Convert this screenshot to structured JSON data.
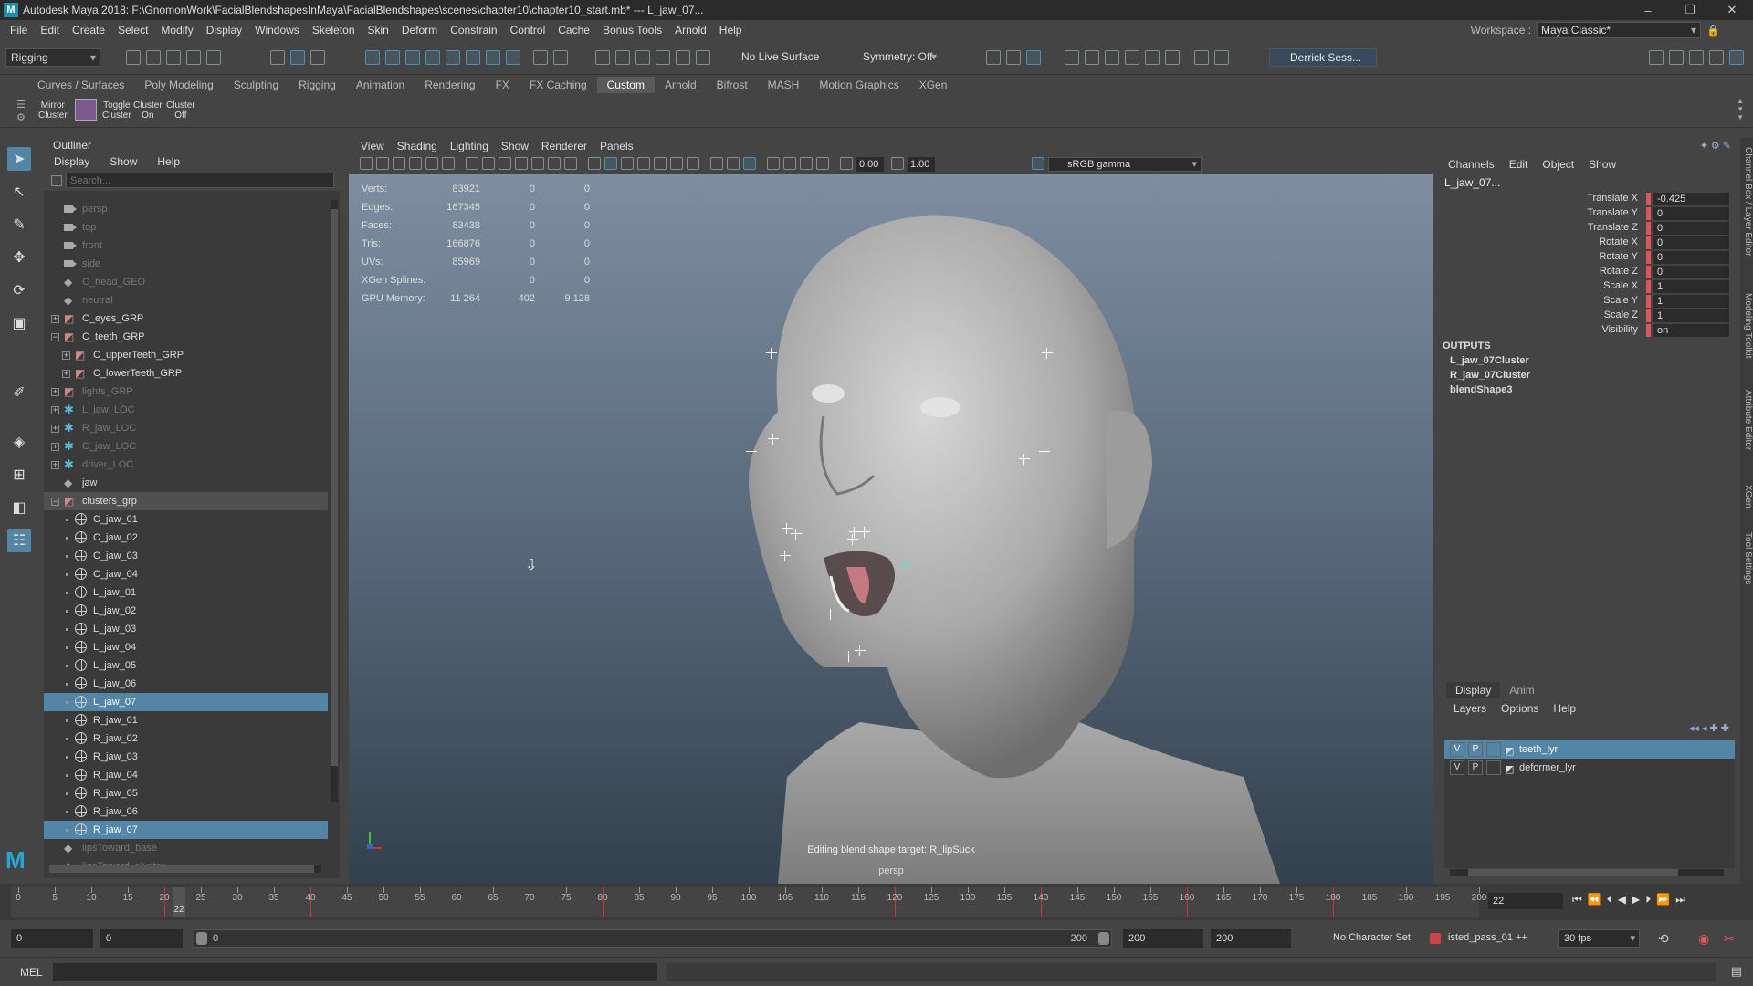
{
  "window": {
    "title": "Autodesk Maya 2018: F:\\GnomonWork\\FacialBlendshapesInMaya\\FacialBlendshapes\\scenes\\chapter10\\chapter10_start.mb*  ---  L_jaw_07...",
    "logo": "M"
  },
  "menu": [
    "File",
    "Edit",
    "Create",
    "Select",
    "Modify",
    "Display",
    "Windows",
    "Skeleton",
    "Skin",
    "Deform",
    "Constrain",
    "Control",
    "Cache",
    "Bonus Tools",
    "Arnold",
    "Help"
  ],
  "workspace": {
    "label": "Workspace :",
    "value": "Maya Classic*"
  },
  "statusline": {
    "mode": "Rigging",
    "live_surface": "No Live Surface",
    "symmetry": "Symmetry: Off",
    "user": "Derrick Sess..."
  },
  "shelf_tabs": [
    "Curves / Surfaces",
    "Poly Modeling",
    "Sculpting",
    "Rigging",
    "Animation",
    "Rendering",
    "FX",
    "FX Caching",
    "Custom",
    "Arnold",
    "Bifrost",
    "MASH",
    "Motion Graphics",
    "XGen"
  ],
  "shelf_items": [
    {
      "l1": "Mirror",
      "l2": "Cluster"
    },
    {
      "l1": "Toggle",
      "l2": "Cluster"
    },
    {
      "l1": "Cluster",
      "l2": "On"
    },
    {
      "l1": "Cluster",
      "l2": "Off"
    }
  ],
  "outliner": {
    "title": "Outliner",
    "menu": [
      "Display",
      "Show",
      "Help"
    ],
    "search_placeholder": "Search...",
    "rows": [
      {
        "label": "persp",
        "icon": "camera-icon",
        "indent": 0,
        "dim": true
      },
      {
        "label": "top",
        "icon": "camera-icon",
        "indent": 0,
        "dim": true
      },
      {
        "label": "front",
        "icon": "camera-icon",
        "indent": 0,
        "dim": true
      },
      {
        "label": "side",
        "icon": "camera-icon",
        "indent": 0,
        "dim": true
      },
      {
        "label": "C_head_GEO",
        "icon": "transform-icon",
        "indent": 0,
        "dim": true
      },
      {
        "label": "neutral",
        "icon": "transform-icon",
        "indent": 0,
        "dim": true
      },
      {
        "label": "C_eyes_GRP",
        "icon": "group-icon",
        "indent": 0,
        "expander": "+"
      },
      {
        "label": "C_teeth_GRP",
        "icon": "group-icon",
        "indent": 0,
        "expander": "−"
      },
      {
        "label": "C_upperTeeth_GRP",
        "icon": "group-icon",
        "indent": 1,
        "expander": "+"
      },
      {
        "label": "C_lowerTeeth_GRP",
        "icon": "group-icon",
        "indent": 1,
        "expander": "+"
      },
      {
        "label": "lights_GRP",
        "icon": "group-icon",
        "indent": 0,
        "expander": "+",
        "dim": true
      },
      {
        "label": "L_jaw_LOC",
        "icon": "locator-icon",
        "indent": 0,
        "expander": "+",
        "dim": true
      },
      {
        "label": "R_jaw_LOC",
        "icon": "locator-icon",
        "indent": 0,
        "expander": "+",
        "dim": true
      },
      {
        "label": "C_jaw_LOC",
        "icon": "locator-icon",
        "indent": 0,
        "expander": "+",
        "dim": true
      },
      {
        "label": "driver_LOC",
        "icon": "locator-icon",
        "indent": 0,
        "expander": "+",
        "dim": true
      },
      {
        "label": "jaw",
        "icon": "transform-icon",
        "indent": 0
      },
      {
        "label": "clusters_grp",
        "icon": "group-icon",
        "indent": 0,
        "expander": "−",
        "grp": true
      },
      {
        "label": "C_jaw_01",
        "icon": "cluster-icon",
        "indent": 1
      },
      {
        "label": "C_jaw_02",
        "icon": "cluster-icon",
        "indent": 1
      },
      {
        "label": "C_jaw_03",
        "icon": "cluster-icon",
        "indent": 1
      },
      {
        "label": "C_jaw_04",
        "icon": "cluster-icon",
        "indent": 1
      },
      {
        "label": "L_jaw_01",
        "icon": "cluster-icon",
        "indent": 1
      },
      {
        "label": "L_jaw_02",
        "icon": "cluster-icon",
        "indent": 1
      },
      {
        "label": "L_jaw_03",
        "icon": "cluster-icon",
        "indent": 1
      },
      {
        "label": "L_jaw_04",
        "icon": "cluster-icon",
        "indent": 1
      },
      {
        "label": "L_jaw_05",
        "icon": "cluster-icon",
        "indent": 1
      },
      {
        "label": "L_jaw_06",
        "icon": "cluster-icon",
        "indent": 1
      },
      {
        "label": "L_jaw_07",
        "icon": "cluster-icon",
        "indent": 1,
        "selected": true
      },
      {
        "label": "R_jaw_01",
        "icon": "cluster-icon",
        "indent": 1
      },
      {
        "label": "R_jaw_02",
        "icon": "cluster-icon",
        "indent": 1
      },
      {
        "label": "R_jaw_03",
        "icon": "cluster-icon",
        "indent": 1
      },
      {
        "label": "R_jaw_04",
        "icon": "cluster-icon",
        "indent": 1
      },
      {
        "label": "R_jaw_05",
        "icon": "cluster-icon",
        "indent": 1
      },
      {
        "label": "R_jaw_06",
        "icon": "cluster-icon",
        "indent": 1
      },
      {
        "label": "R_jaw_07",
        "icon": "cluster-icon",
        "indent": 1,
        "selected": true
      },
      {
        "label": "lipsToward_base",
        "icon": "transform-icon",
        "indent": 0,
        "dim": true
      },
      {
        "label": "lipsToward_cluster",
        "icon": "transform-icon",
        "indent": 0,
        "dim": true
      }
    ]
  },
  "viewport": {
    "menu": [
      "View",
      "Shading",
      "Lighting",
      "Show",
      "Renderer",
      "Panels"
    ],
    "exposure": "0.00",
    "gamma": "1.00",
    "color_space": "sRGB gamma",
    "hud": [
      {
        "label": "Verts:",
        "v1": "83921",
        "v2": "0",
        "v3": "0"
      },
      {
        "label": "Edges:",
        "v1": "167345",
        "v2": "0",
        "v3": "0"
      },
      {
        "label": "Faces:",
        "v1": "83438",
        "v2": "0",
        "v3": "0"
      },
      {
        "label": "Tris:",
        "v1": "166876",
        "v2": "0",
        "v3": "0"
      },
      {
        "label": "UVs:",
        "v1": "85969",
        "v2": "0",
        "v3": "0"
      },
      {
        "label": "XGen Splines:",
        "v1": "",
        "v2": "0",
        "v3": "0"
      },
      {
        "label": "GPU Memory:",
        "v1": "11 264",
        "v2": "402",
        "v3": "9 128"
      }
    ],
    "message": "Editing blend shape target: R_lipSuck",
    "camera": "persp"
  },
  "channel_box": {
    "menu": [
      "Channels",
      "Edit",
      "Object",
      "Show"
    ],
    "object": "L_jaw_07...",
    "attrs": [
      {
        "name": "Translate X",
        "value": "-0.425"
      },
      {
        "name": "Translate Y",
        "value": "0"
      },
      {
        "name": "Translate Z",
        "value": "0"
      },
      {
        "name": "Rotate X",
        "value": "0"
      },
      {
        "name": "Rotate Y",
        "value": "0"
      },
      {
        "name": "Rotate Z",
        "value": "0"
      },
      {
        "name": "Scale X",
        "value": "1"
      },
      {
        "name": "Scale Y",
        "value": "1"
      },
      {
        "name": "Scale Z",
        "value": "1"
      },
      {
        "name": "Visibility",
        "value": "on"
      }
    ],
    "outputs_title": "OUTPUTS",
    "outputs": [
      "L_jaw_07Cluster",
      "R_jaw_07Cluster",
      "blendShape3"
    ]
  },
  "layers": {
    "tabs": [
      "Display",
      "Anim"
    ],
    "menu": [
      "Layers",
      "Options",
      "Help"
    ],
    "rows": [
      {
        "v": "V",
        "p": "P",
        "name": "teeth_lyr",
        "selected": true
      },
      {
        "v": "V",
        "p": "P",
        "name": "deformer_lyr",
        "selected": false
      }
    ]
  },
  "side_tabs": [
    "Channel Box / Layer Editor",
    "Modeling Toolkit",
    "Attribute Editor",
    "XGen",
    "Tool Settings"
  ],
  "timeline": {
    "start": 0,
    "end": 200,
    "step": 5,
    "label_every": 5,
    "current": "22",
    "keys": [
      20,
      40,
      60,
      80,
      120,
      140,
      160,
      180
    ],
    "frame_input": "22"
  },
  "range": {
    "start": "0",
    "inner_start": "0",
    "slider_start": "0",
    "slider_end": "200",
    "end": "200",
    "outer_end": "200",
    "character_set": "No Character Set",
    "anim_layer": "isted_pass_01 ++",
    "fps": "30 fps"
  },
  "command": {
    "label": "MEL"
  }
}
